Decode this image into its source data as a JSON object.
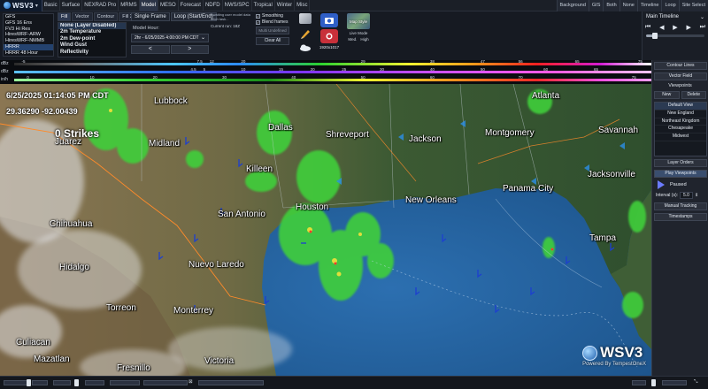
{
  "app": {
    "logo_text": "WSV3",
    "menu_tabs": [
      "Basic",
      "Surface",
      "NEXRAD Pro",
      "MRMS",
      "Model",
      "MESO",
      "Forecast",
      "NDFD",
      "NWS/SPC",
      "Tropical",
      "Winter",
      "Misc"
    ],
    "active_menu_tab": "Model",
    "right_tabs": [
      "Background",
      "GIS",
      "Both",
      "None"
    ]
  },
  "panel": {
    "models": [
      "GFS",
      "GFS 16 Ens",
      "FV3 Hi Res",
      "HiresWRF-ARW",
      "HiresWRF-NMMB",
      "HRRR",
      "HRRR 48 Hour"
    ],
    "selected_model": "HRRR",
    "fill_tabs": [
      "Fill",
      "Vector",
      "Contour",
      "Fill 2"
    ],
    "layers": [
      "None (Layer Disabled)",
      "2m Temperature",
      "2m Dew-point",
      "Wind Gust",
      "Reflectivity"
    ],
    "frame_tabs": [
      "Single Frame",
      "Loop (Start/End)"
    ],
    "model_hour_label": "Model Hour:",
    "model_hour_value": "2hr - 6/25/2025 4:00:00 PM CDT",
    "prev_symbol": "<",
    "next_symbol": ">",
    "status_msg": "Awaiting user model data fetch task...",
    "current_run_label": "Current run: 18Z",
    "smoothing_label": "Smoothing",
    "blend_label": "Blend frames",
    "multi_label": "Multi Undefined",
    "clear_all_label": "Clear All",
    "resolution_label": "1920x1017",
    "map_style_label": "Map Style",
    "live_mode_label": "Live Mode",
    "med_label": "Med.",
    "high_label": "High"
  },
  "timeline": {
    "title": "Main Timeline",
    "progress_percent": 15,
    "tabs": [
      "Timeline",
      "Loop",
      "Site Select"
    ]
  },
  "scales": {
    "rows": [
      {
        "unit": "dBz",
        "ticks": [
          "-5",
          "7.5",
          "12",
          "20",
          "29",
          "38",
          "47",
          "56",
          "65",
          "75"
        ]
      },
      {
        "unit": "dBz",
        "ticks": [
          "4.5",
          "5",
          "10",
          "15",
          "20",
          "25",
          "30",
          "40",
          "50",
          "60",
          "65"
        ]
      },
      {
        "unit": "in/h",
        "ticks": [
          "0",
          "10",
          "20",
          "30",
          "40",
          "50",
          "60",
          "70",
          "75"
        ]
      }
    ]
  },
  "map": {
    "date": "6/25/2025 01:14:05 PM CDT",
    "coords": "29.36290 -92.00439",
    "strikes": "0 Strikes",
    "cities": [
      {
        "id": "lubbock",
        "name": "Lubbock"
      },
      {
        "id": "juarez",
        "name": "Juarez"
      },
      {
        "id": "midland",
        "name": "Midland"
      },
      {
        "id": "dallas",
        "name": "Dallas"
      },
      {
        "id": "shreveport",
        "name": "Shreveport"
      },
      {
        "id": "jackson",
        "name": "Jackson"
      },
      {
        "id": "montgomery",
        "name": "Montgomery"
      },
      {
        "id": "atlanta",
        "name": "Atlanta"
      },
      {
        "id": "savannah",
        "name": "Savannah"
      },
      {
        "id": "killeen",
        "name": "Killeen"
      },
      {
        "id": "jacksonville",
        "name": "Jacksonville"
      },
      {
        "id": "san-antonio",
        "name": "San Antonio"
      },
      {
        "id": "houston",
        "name": "Houston"
      },
      {
        "id": "new-orleans",
        "name": "New Orleans"
      },
      {
        "id": "panama-city",
        "name": "Panama City"
      },
      {
        "id": "chihuahua",
        "name": "Chihuahua"
      },
      {
        "id": "tampa",
        "name": "Tampa"
      },
      {
        "id": "hidalgo",
        "name": "Hidalgo"
      },
      {
        "id": "nuevo-laredo",
        "name": "Nuevo Laredo"
      },
      {
        "id": "torreon",
        "name": "Torreon"
      },
      {
        "id": "monterrey",
        "name": "Monterrey"
      },
      {
        "id": "culiacan",
        "name": "Culiacan"
      },
      {
        "id": "mazatlan",
        "name": "Mazatlan"
      },
      {
        "id": "fresnillo",
        "name": "Fresnillo"
      },
      {
        "id": "victoria",
        "name": "Victoria"
      }
    ],
    "brand": "WSV3",
    "brand_sub": "Powered By TempestOneX"
  },
  "sidebar": {
    "contour_lines": "Contour Lines",
    "vector_field": "Vector Field",
    "viewpoints": "Viewpoints",
    "new": "New",
    "delete": "Delete",
    "viewpoint_list": [
      "Default View",
      "New England",
      "Northeast Kingdom",
      "Chesapeake",
      "Midwest"
    ],
    "layer_orders": "Layer Orders",
    "play_viewpoints": "Play Viewpoints",
    "paused": "Paused",
    "interval_label": "Interval (s):",
    "interval_value": "5.0",
    "manual_tracking": "Manual Tracking",
    "timestamps": "Timestamps"
  },
  "colors": {
    "accent": "#2e3a52",
    "gulf": "#1f5d96",
    "land": "#8c7a55",
    "radar": "#3fcf3a"
  }
}
